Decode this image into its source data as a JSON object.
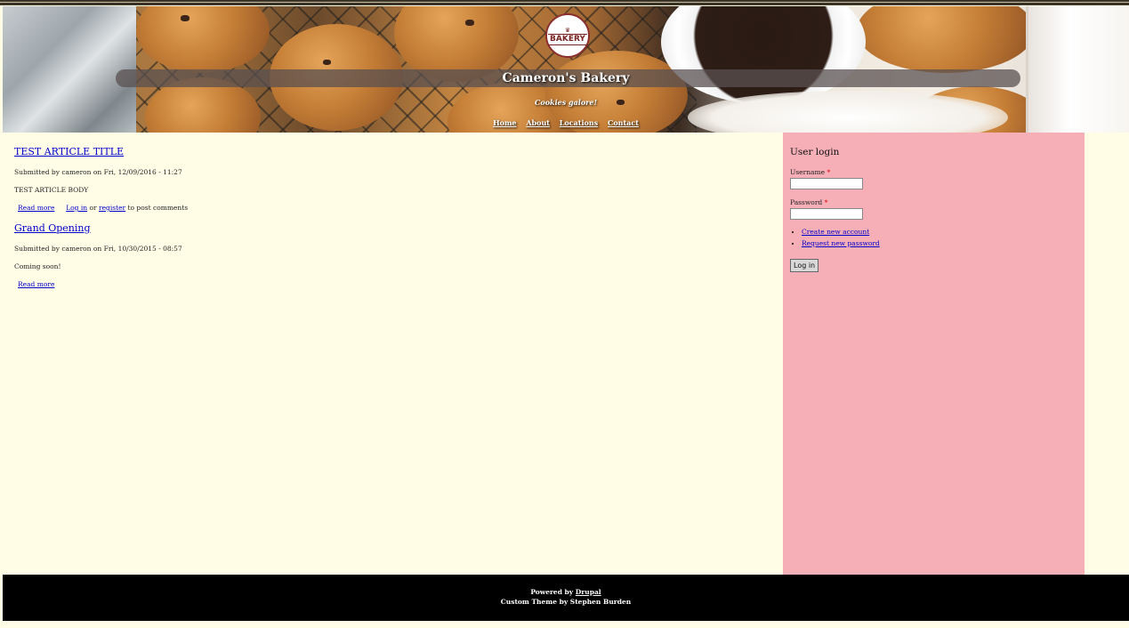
{
  "site": {
    "name": "Cameron's Bakery",
    "slogan": "Cookies galore!",
    "logo_text": "BAKERY"
  },
  "main_menu": [
    {
      "label": "Home"
    },
    {
      "label": "About"
    },
    {
      "label": "Locations"
    },
    {
      "label": "Contact"
    }
  ],
  "articles": [
    {
      "title": "TEST ARTICLE TITLE",
      "submitted": "Submitted by cameron on Fri, 12/09/2016 - 11:27",
      "body": "TEST ARTICLE BODY",
      "read_more": "Read more",
      "login_link": "Log in",
      "or_text": "or",
      "register_link": "register",
      "comment_text": "to post comments"
    },
    {
      "title": "Grand Opening",
      "submitted": "Submitted by cameron on Fri, 10/30/2015 - 08:57",
      "body": "Coming soon!",
      "read_more": "Read more"
    }
  ],
  "login_block": {
    "title": "User login",
    "username_label": "Username",
    "password_label": "Password",
    "required_marker": "*",
    "username_value": "",
    "password_value": "",
    "links": [
      "Create new account",
      "Request new password"
    ],
    "submit_label": "Log in"
  },
  "footer": {
    "powered_by": "Powered by",
    "drupal_link": "Drupal",
    "theme_credit": "Custom Theme by Stephen Burden"
  },
  "colors": {
    "background": "#fffde6",
    "sidebar": "#f6aeb7",
    "footer": "#000000",
    "link": "#0000cc"
  }
}
